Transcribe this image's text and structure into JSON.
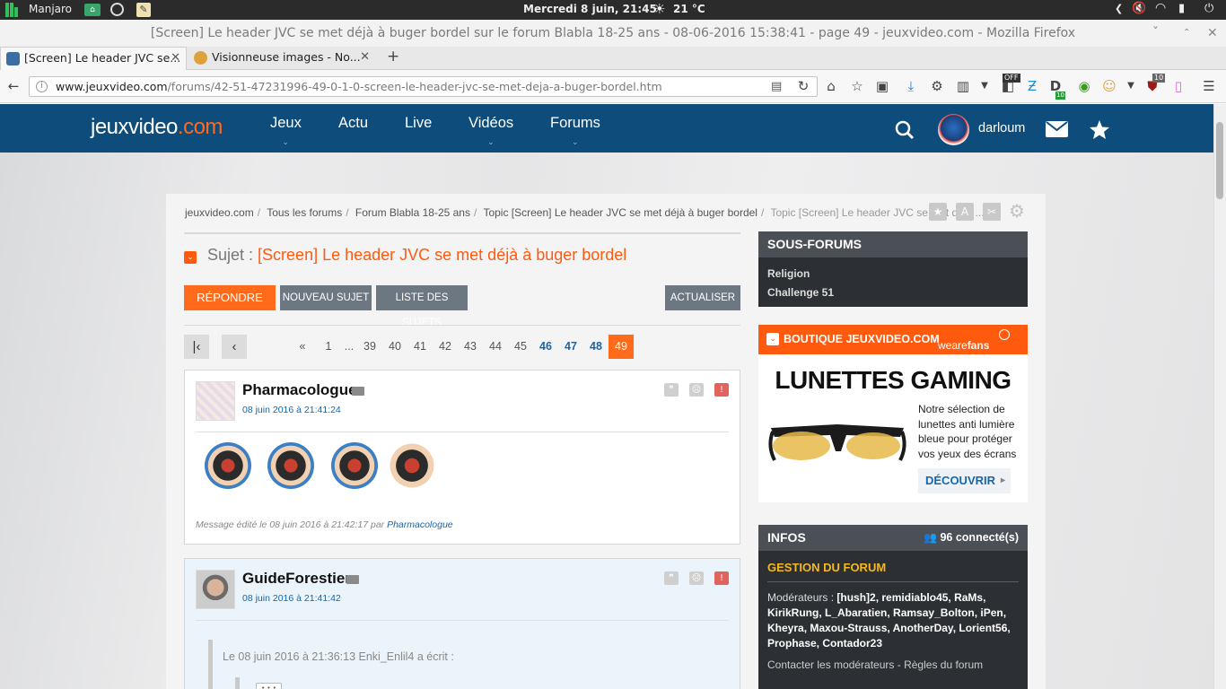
{
  "system_bar": {
    "app_name": "Manjaro",
    "clock": "Mercredi  8 juin, 21:45",
    "temperature": "21 °C"
  },
  "window": {
    "title": "[Screen] Le header JVC se met déjà à buger bordel sur le forum Blabla 18-25 ans - 08-06-2016 15:38:41 - page 49 - jeuxvideo.com - Mozilla Firefox"
  },
  "tabs": [
    {
      "label": "[Screen] Le header JVC se..."
    },
    {
      "label": "Visionneuse images - No..."
    }
  ],
  "navbar": {
    "url_domain": "www.jeuxvideo.com",
    "url_path": "/forums/42-51-47231996-49-0-1-0-screen-le-header-jvc-se-met-deja-a-buger-bordel.htm",
    "addon_badges": {
      "off": "OFF",
      "ten_a": "10",
      "ten_b": "10"
    }
  },
  "site_header": {
    "logo_main": "jeuxvideo",
    "logo_suffix": ".com",
    "nav": [
      "Jeux",
      "Actu",
      "Live",
      "Vidéos",
      "Forums"
    ],
    "username": "darloum"
  },
  "breadcrumb": [
    "jeuxvideo.com",
    "Tous les forums",
    "Forum Blabla 18-25 ans",
    "Topic [Screen] Le header JVC se met déjà à buger bordel",
    "Topic [Screen] Le header JVC se met déjà ..."
  ],
  "topic": {
    "subject_prefix": "Sujet :",
    "subject": "[Screen] Le header JVC se met déjà à buger bordel"
  },
  "buttons": {
    "reply": "RÉPONDRE",
    "new_topic": "NOUVEAU SUJET",
    "topic_list": "LISTE DES SUJETS",
    "refresh": "ACTUALISER"
  },
  "pagination": {
    "first": "«",
    "pages_plain": [
      "1",
      "...",
      "39",
      "40",
      "41",
      "42",
      "43",
      "44",
      "45"
    ],
    "pages_blue": [
      "46",
      "47",
      "48"
    ],
    "current": "49"
  },
  "posts": [
    {
      "author": "Pharmacologue",
      "date": "08 juin 2016 à 21:41:24",
      "edit_note": "Message édité le 08 juin 2016 à 21:42:17 par",
      "edit_author": "Pharmacologue"
    },
    {
      "author": "GuideForestier",
      "date": "08 juin 2016 à 21:41:42",
      "quote_header": "Le 08 juin 2016 à 21:36:13 Enki_Enlil4 a écrit :",
      "quote_ellipsis": "• • •"
    }
  ],
  "sidebar": {
    "sous_forums": {
      "title": "SOUS-FORUMS",
      "items": [
        "Religion",
        "Challenge 51"
      ]
    },
    "boutique": {
      "title": "BOUTIQUE JEUXVIDEO.COM",
      "brand_prefix": "weare",
      "brand_suffix": "fans",
      "product_title": "LUNETTES GAMING",
      "description": "Notre sélection de lunettes anti lumière bleue pour protéger vos yeux des écrans",
      "cta": "DÉCOUVRIR"
    },
    "infos": {
      "title": "INFOS",
      "connected": "96 connecté(s)",
      "gestion_title": "GESTION DU FORUM",
      "moderators_label": "Modérateurs :",
      "moderators": "[hush]2, remidiablo45, RaMs, KirikRung, L_Abaratien, Ramsay_Bolton, iPen, Kheyra, Maxou-Strauss, AnotherDay, Lorient56, Prophase, Contador23",
      "contact": "Contacter les modérateurs",
      "separator": "-",
      "rules": "Règles du forum"
    }
  }
}
